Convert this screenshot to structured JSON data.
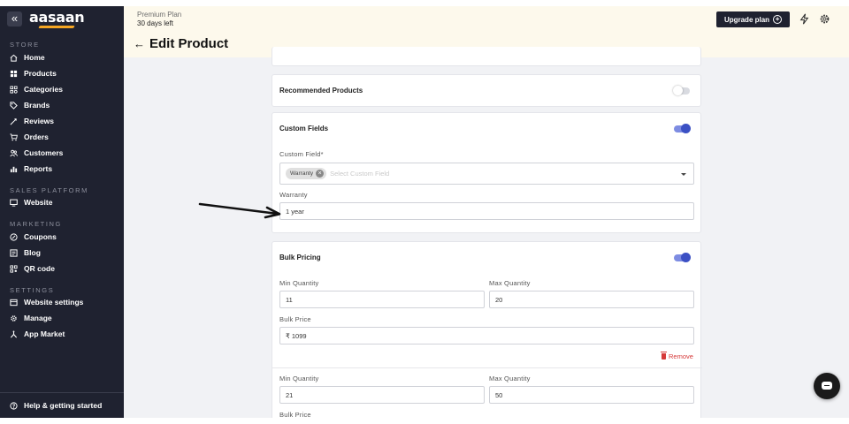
{
  "sidebar": {
    "logo": "aasaan",
    "collapse_glyph": "«",
    "sections": {
      "store": "STORE",
      "sales_platform": "SALES PLATFORM",
      "marketing": "MARKETING",
      "settings": "SETTINGS"
    },
    "store_items": [
      {
        "label": "Home",
        "icon": "home-icon"
      },
      {
        "label": "Products",
        "icon": "products-icon"
      },
      {
        "label": "Categories",
        "icon": "categories-icon"
      },
      {
        "label": "Brands",
        "icon": "tag-icon"
      },
      {
        "label": "Reviews",
        "icon": "thumb-icon"
      },
      {
        "label": "Orders",
        "icon": "cart-icon"
      },
      {
        "label": "Customers",
        "icon": "users-icon"
      },
      {
        "label": "Reports",
        "icon": "bar-chart-icon"
      }
    ],
    "sales_items": [
      {
        "label": "Website",
        "icon": "monitor-icon"
      }
    ],
    "marketing_items": [
      {
        "label": "Coupons",
        "icon": "coupon-icon"
      },
      {
        "label": "Blog",
        "icon": "blog-icon"
      },
      {
        "label": "QR code",
        "icon": "qr-icon"
      }
    ],
    "settings_items": [
      {
        "label": "Website settings",
        "icon": "browser-icon"
      },
      {
        "label": "Manage",
        "icon": "gear-icon"
      },
      {
        "label": "App Market",
        "icon": "app-market-icon"
      }
    ],
    "help": {
      "label": "Help & getting started",
      "icon": "help-icon"
    }
  },
  "header": {
    "plan": "Premium Plan",
    "days_left": "30 days left",
    "back_glyph": "←",
    "title": "Edit Product",
    "upgrade_label": "Upgrade plan",
    "upgrade_glyph": "+"
  },
  "recommended": {
    "title": "Recommended Products",
    "enabled": false
  },
  "custom_fields": {
    "title": "Custom Fields",
    "enabled": true,
    "field_label": "Custom Field*",
    "selected_chip": "Warranty",
    "chip_remove_glyph": "×",
    "placeholder": "Select Custom Field",
    "value_label": "Warranty",
    "value": "1 year"
  },
  "bulk_pricing": {
    "title": "Bulk Pricing",
    "enabled": true,
    "remove_label": "Remove",
    "tiers": [
      {
        "min_label": "Min Quantity",
        "min": "11",
        "max_label": "Max Quantity",
        "max": "20",
        "price_label": "Bulk Price",
        "price": "₹  1099"
      },
      {
        "min_label": "Min Quantity",
        "min": "21",
        "max_label": "Max Quantity",
        "max": "50",
        "price_label": "Bulk Price"
      }
    ]
  },
  "colors": {
    "sidebar_bg": "#1f2230",
    "topbar_bg": "#fdf9ec",
    "toggle_on": "#3b50c4",
    "remove": "#d63a3a",
    "logo_accent": "#f5a623"
  }
}
